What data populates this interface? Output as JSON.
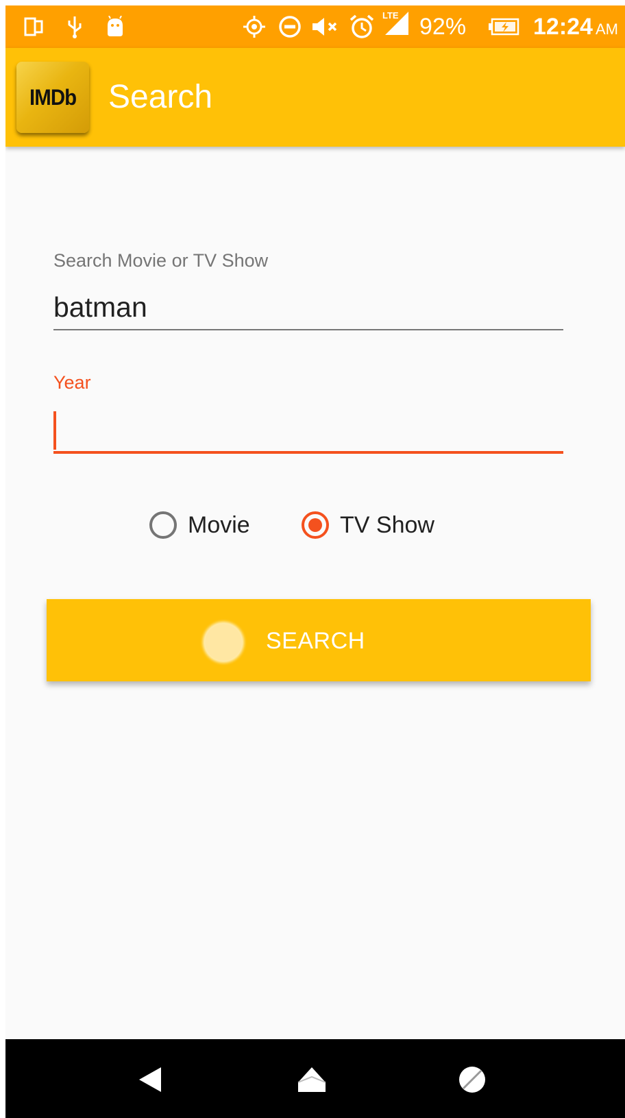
{
  "status_bar": {
    "battery": "92%",
    "time": "12:24",
    "time_suffix": "AM",
    "network": "LTE",
    "icons": [
      "screen-mirror-icon",
      "usb-icon",
      "android-icon",
      "gps-icon",
      "do-not-disturb-icon",
      "mute-icon",
      "alarm-icon",
      "lte-signal-icon",
      "battery-charging-icon"
    ]
  },
  "app_bar": {
    "logo_text": "IMDb",
    "title": "Search"
  },
  "form": {
    "search_label": "Search Movie or TV Show",
    "search_value": "batman",
    "year_label": "Year",
    "year_value": ""
  },
  "radios": {
    "movie_label": "Movie",
    "tv_label": "TV Show",
    "selected": "TV Show"
  },
  "button": {
    "label": "SEARCH"
  },
  "colors": {
    "status_bar": "#ffa000",
    "app_bar": "#ffc107",
    "accent": "#f4511e",
    "background": "#fafafa"
  },
  "nav": {
    "icons": [
      "back-icon",
      "home-icon",
      "recents-icon"
    ]
  }
}
